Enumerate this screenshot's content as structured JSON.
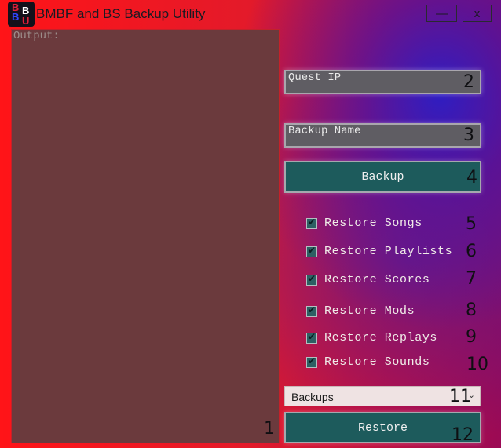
{
  "window": {
    "title": "BMBF and BS Backup Utility",
    "icon_letters": [
      "B",
      "B",
      "B",
      "U"
    ],
    "minimize_label": "—",
    "close_label": "x"
  },
  "output": {
    "label": "Output:",
    "num": "1"
  },
  "quest_ip": {
    "placeholder": "Quest IP",
    "num": "2"
  },
  "backup_name": {
    "placeholder": "Backup Name",
    "num": "3"
  },
  "backup_button": {
    "label": "Backup",
    "num": "4"
  },
  "restore_options": [
    {
      "label": "Restore Songs",
      "checked": true,
      "num": "5"
    },
    {
      "label": "Restore Playlists",
      "checked": true,
      "num": "6"
    },
    {
      "label": "Restore Scores",
      "checked": true,
      "num": "7"
    },
    {
      "label": "Restore Mods",
      "checked": true,
      "num": "8"
    },
    {
      "label": "Restore Replays",
      "checked": true,
      "num": "9"
    },
    {
      "label": "Restore Sounds",
      "checked": true,
      "num": "10"
    }
  ],
  "backups_select": {
    "selected": "Backups",
    "num": "11"
  },
  "restore_button": {
    "label": "Restore",
    "num": "12"
  },
  "colors": {
    "teal_button": "#1d5b5c",
    "output_bg": "#6b3a3d",
    "field_bg": "#5f5d63"
  }
}
